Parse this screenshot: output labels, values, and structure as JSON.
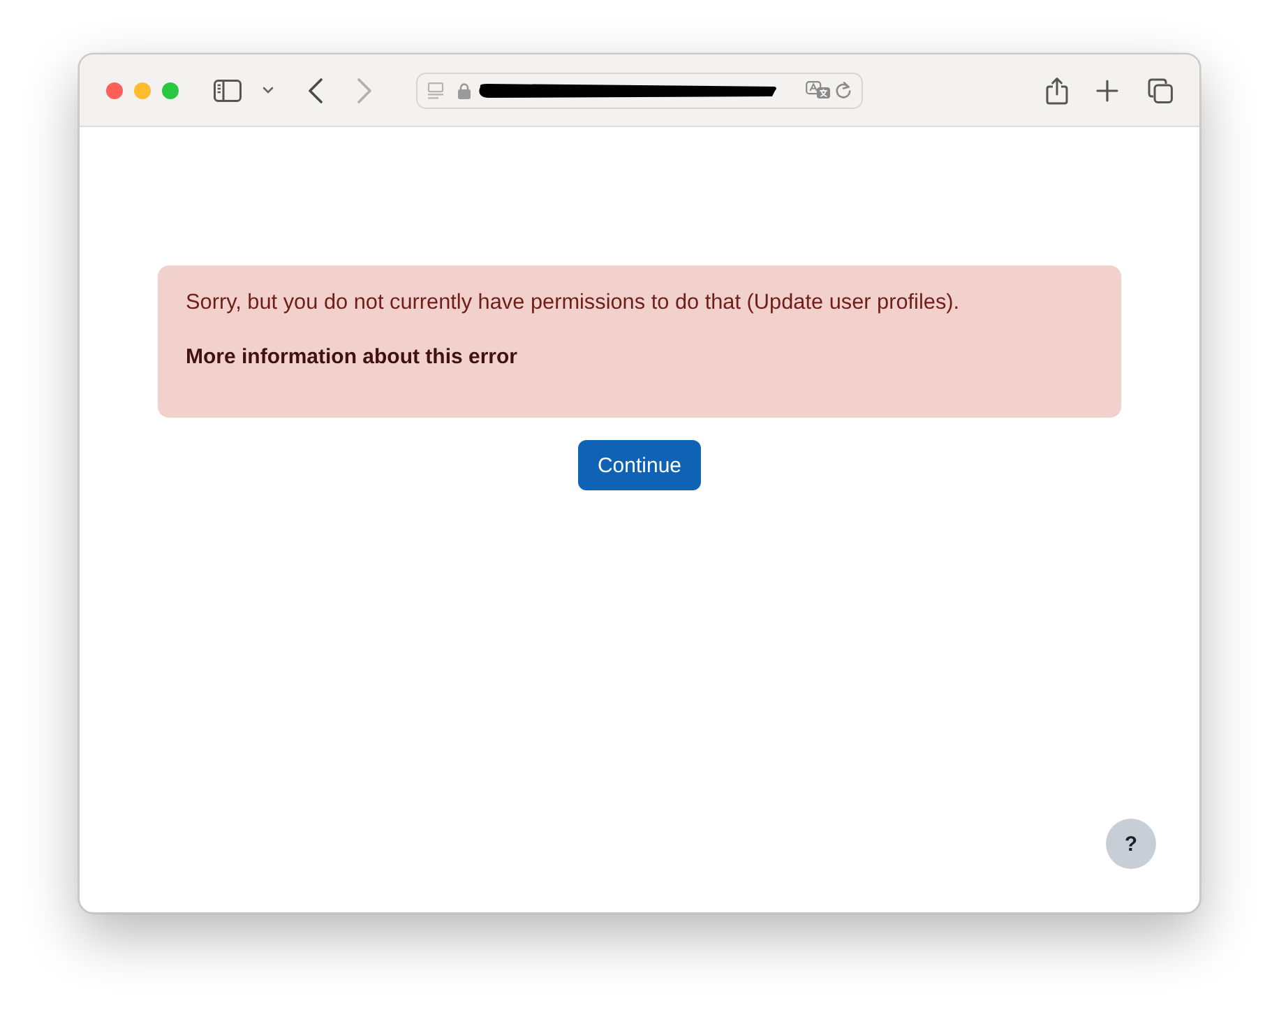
{
  "browser": {
    "nav_buttons": [
      {
        "kind": "back",
        "disabled": false
      },
      {
        "kind": "forward",
        "disabled": true
      }
    ]
  },
  "alert": {
    "message": "Sorry, but you do not currently have permissions to do that (Update user profiles).",
    "link": "More information about this error"
  },
  "continue_button": "Continue",
  "help_button": "?"
}
